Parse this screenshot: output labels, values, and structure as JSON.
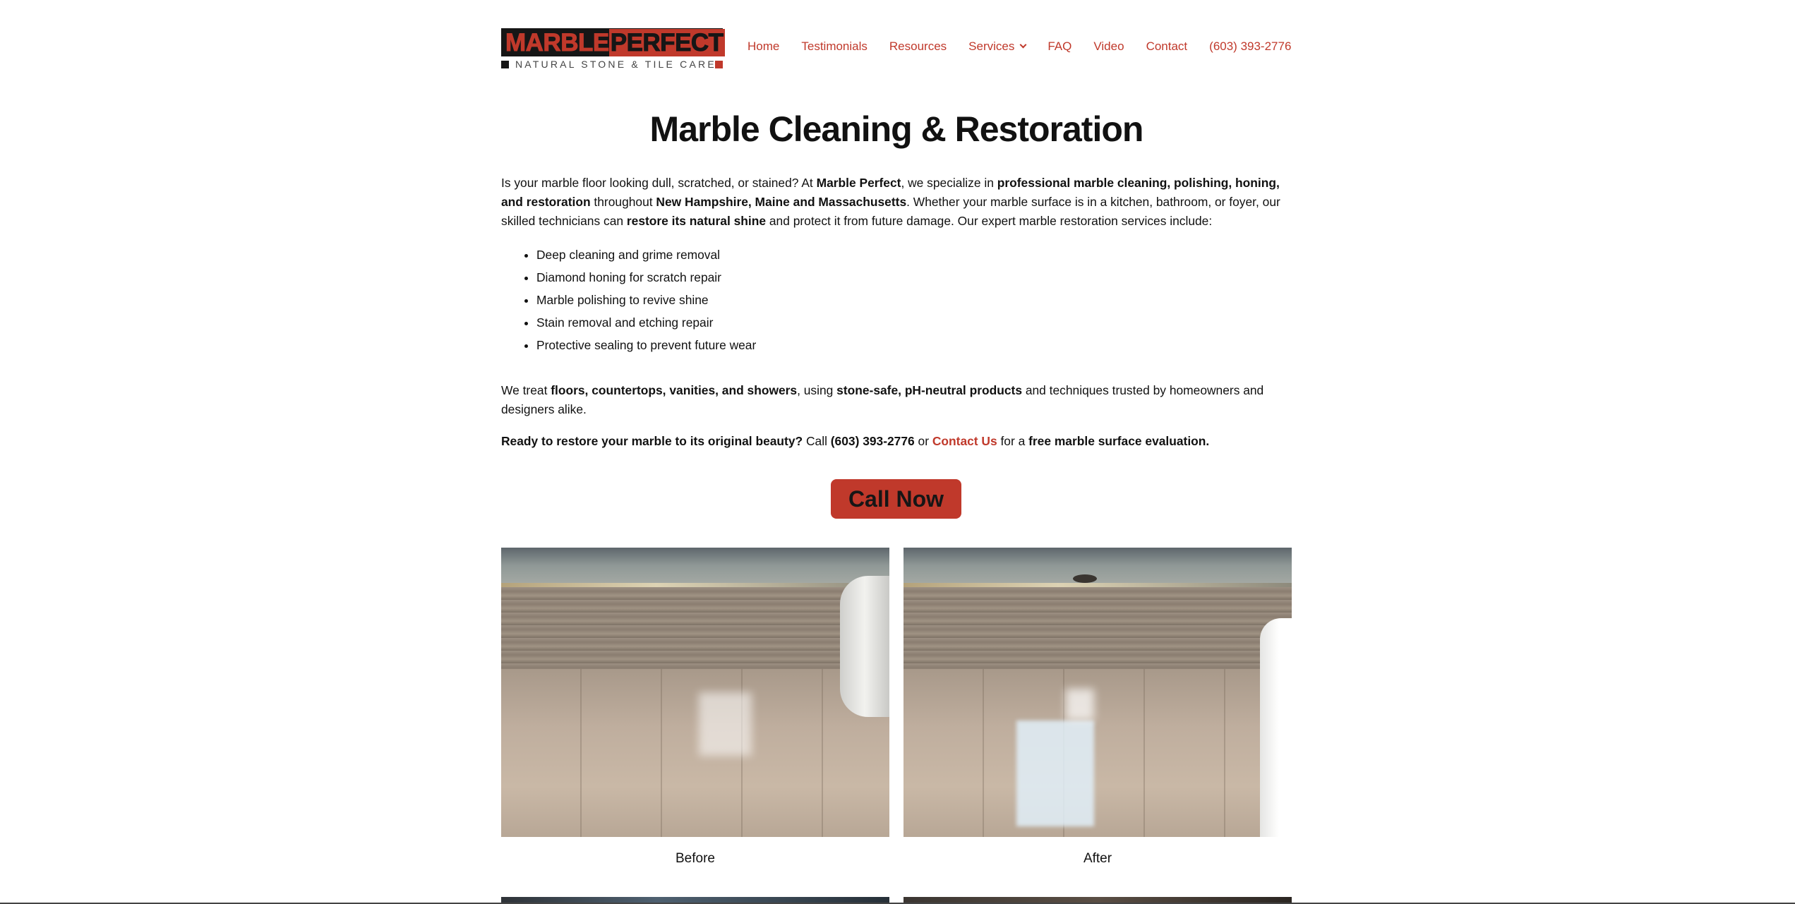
{
  "header": {
    "logo": {
      "word1": "MARBLE",
      "word2": "PERFECT",
      "tagline": "NATURAL STONE & TILE CARE"
    },
    "nav": [
      {
        "label": "Home"
      },
      {
        "label": "Testimonials"
      },
      {
        "label": "Resources"
      },
      {
        "label": "Services",
        "has_dropdown": true
      },
      {
        "label": "FAQ"
      },
      {
        "label": "Video"
      },
      {
        "label": "Contact"
      },
      {
        "label": "(603) 393-2776"
      }
    ]
  },
  "main": {
    "title": "Marble Cleaning & Restoration",
    "intro": {
      "t1": "Is your marble floor looking dull, scratched, or stained? At ",
      "b1": "Marble Perfect",
      "t2": ", we specialize in ",
      "b2": "professional marble cleaning, polishing, honing, and restoration",
      "t3": " throughout ",
      "b3": "New Hampshire, Maine and Massachusetts",
      "t4": ". Whether your marble surface is in a kitchen, bathroom, or foyer, our skilled technicians can ",
      "b4": "restore its natural shine",
      "t5": " and protect it from future damage. Our expert marble restoration services include:"
    },
    "services": [
      "Deep cleaning and grime removal",
      "Diamond honing for scratch repair",
      "Marble polishing to revive shine",
      "Stain removal and etching repair",
      "Protective sealing to prevent future wear"
    ],
    "p2": {
      "t1": "We treat ",
      "b1": "floors, countertops, vanities, and showers",
      "t2": ", using ",
      "b2": "stone-safe, pH-neutral products",
      "t3": " and techniques trusted by homeowners and designers alike."
    },
    "p3": {
      "b1": "Ready to restore your marble to its original beauty?",
      "t1": " Call ",
      "b2": "(603) 393-2776",
      "t2": " or ",
      "link": "Contact Us",
      "t3": " for a ",
      "b3": "free marble surface evaluation."
    },
    "cta_label": "Call Now",
    "gallery": {
      "before_caption": "Before",
      "after_caption": "After"
    }
  },
  "colors": {
    "accent": "#c0392b",
    "text": "#111111",
    "background": "#ffffff"
  }
}
